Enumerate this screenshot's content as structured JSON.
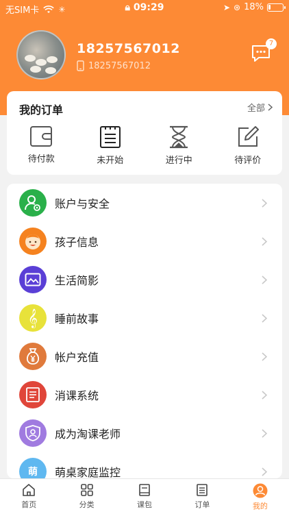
{
  "status_bar": {
    "carrier": "无SIM卡",
    "time": "09:29",
    "battery": "18%",
    "battery_level": 0.18
  },
  "profile": {
    "name": "18257567012",
    "phone": "18257567012",
    "message_count": "7"
  },
  "orders": {
    "title": "我的订单",
    "all_label": "全部",
    "items": [
      {
        "label": "待付款",
        "icon": "wallet-icon"
      },
      {
        "label": "未开始",
        "icon": "clipboard-icon"
      },
      {
        "label": "进行中",
        "icon": "hourglass-icon"
      },
      {
        "label": "待评价",
        "icon": "edit-icon"
      }
    ]
  },
  "menu": {
    "items": [
      {
        "label": "账户与安全",
        "icon": "account-security-icon",
        "color": "#2ab04a"
      },
      {
        "label": "孩子信息",
        "icon": "child-face-icon",
        "color": "#f5821f"
      },
      {
        "label": "生活简影",
        "icon": "photo-icon",
        "color": "#5a3fd6"
      },
      {
        "label": "睡前故事",
        "icon": "music-note-icon",
        "color": "#e8e23a"
      },
      {
        "label": "帐户充值",
        "icon": "money-bag-icon",
        "color": "#e07a3c"
      },
      {
        "label": "消课系统",
        "icon": "book-icon",
        "color": "#e0463a"
      },
      {
        "label": "成为淘课老师",
        "icon": "teacher-badge-icon",
        "color": "#a07be0"
      },
      {
        "label": "萌桌家庭监控",
        "icon": "mengzhuo-logo-icon",
        "color": "#5fb8f0"
      }
    ]
  },
  "tabs": [
    {
      "label": "首页",
      "icon": "home-icon"
    },
    {
      "label": "分类",
      "icon": "grid-icon"
    },
    {
      "label": "课包",
      "icon": "package-icon"
    },
    {
      "label": "订单",
      "icon": "order-list-icon"
    },
    {
      "label": "我的",
      "icon": "profile-icon"
    }
  ],
  "colors": {
    "accent": "#fd8a35"
  }
}
